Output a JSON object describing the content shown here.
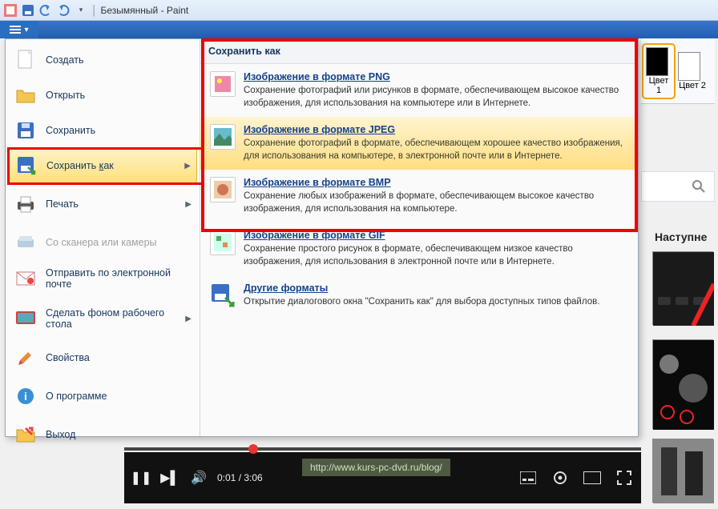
{
  "window": {
    "title": "Безымянный - Paint"
  },
  "ribbon": {
    "color1_label": "Цвет 1",
    "color2_label": "Цвет 2"
  },
  "file_menu": {
    "items": [
      {
        "label": "Создать",
        "icon": "new"
      },
      {
        "label": "Открыть",
        "icon": "open"
      },
      {
        "label": "Сохранить",
        "icon": "save"
      },
      {
        "label": "Сохранить как",
        "icon": "saveas",
        "submenu": true,
        "highlight": true
      },
      {
        "label": "Печать",
        "icon": "print",
        "submenu": true
      },
      {
        "label": "Со сканера или камеры",
        "icon": "scanner",
        "disabled": true
      },
      {
        "label": "Отправить по электронной почте",
        "icon": "mail"
      },
      {
        "label": "Сделать фоном рабочего стола",
        "icon": "wallpaper",
        "submenu": true
      },
      {
        "label": "Свойства",
        "icon": "properties"
      },
      {
        "label": "О программе",
        "icon": "about"
      },
      {
        "label": "Выход",
        "icon": "exit"
      }
    ]
  },
  "saveas_panel": {
    "header": "Сохранить как",
    "formats": [
      {
        "title": "Изображение в формате PNG",
        "desc": "Сохранение фотографий или рисунков в формате, обеспечивающем высокое качество изображения, для использования на компьютере или в Интернете.",
        "icon": "png"
      },
      {
        "title": "Изображение в формате JPEG",
        "desc": "Сохранение фотографий в формате, обеспечивающем хорошее качество изображения, для использования на компьютере, в электронной почте или в Интернете.",
        "icon": "jpeg",
        "highlight": true
      },
      {
        "title": "Изображение в формате BMP",
        "desc": "Сохранение любых изображений в формате, обеспечивающем высокое качество изображения, для использования на компьютере.",
        "icon": "bmp"
      },
      {
        "title": "Изображение в формате GIF",
        "desc": "Сохранение простого рисунок в формате, обеспечивающем низкое качество изображения, для использования в электронной почте или в Интернете.",
        "icon": "gif"
      },
      {
        "title": "Другие форматы",
        "desc": "Открытие диалогового окна \"Сохранить как\" для выбора доступных типов файлов.",
        "icon": "other"
      }
    ]
  },
  "sidebar": {
    "next_label": "Наступне"
  },
  "player": {
    "current_time": "0:01",
    "total_time": "3:06",
    "url": "http://www.kurs-pc-dvd.ru/blog/"
  }
}
